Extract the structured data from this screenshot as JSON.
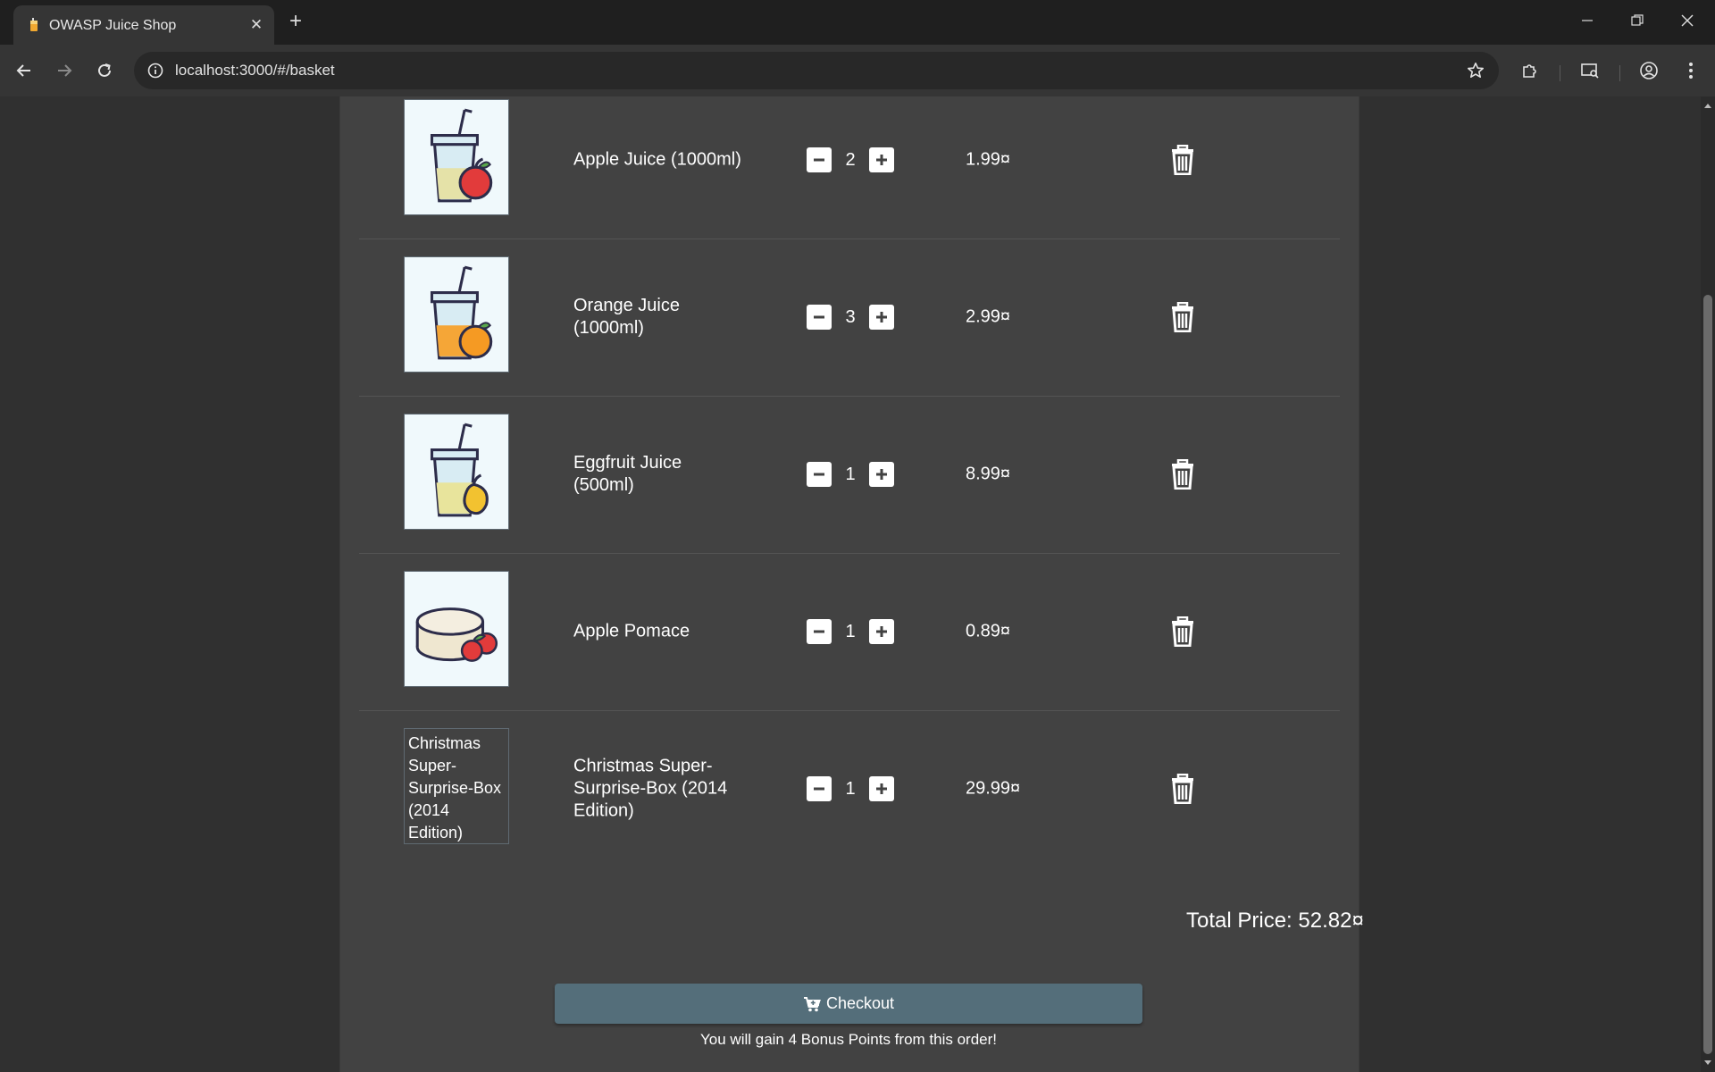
{
  "browser": {
    "tab_title": "OWASP Juice Shop",
    "url": "localhost:3000/#/basket"
  },
  "icons": {
    "favicon": "juice-shop-favicon",
    "back": "back-arrow-icon",
    "forward": "forward-arrow-icon",
    "reload": "reload-icon",
    "site_info": "info-icon",
    "bookmark": "star-icon",
    "extensions": "puzzle-icon",
    "profile": "profile-icon",
    "menu": "kebab-menu-icon",
    "decrease": "minus-square-icon",
    "increase": "plus-square-icon",
    "delete": "trash-icon",
    "checkout": "cart-icon"
  },
  "basket": {
    "items": [
      {
        "name": "Apple Juice (1000ml)",
        "quantity": "2",
        "price": "1.99¤",
        "image": "apple-juice"
      },
      {
        "name": "Orange Juice (1000ml)",
        "quantity": "3",
        "price": "2.99¤",
        "image": "orange-juice"
      },
      {
        "name": "Eggfruit Juice (500ml)",
        "quantity": "1",
        "price": "8.99¤",
        "image": "eggfruit-juice"
      },
      {
        "name": "Apple Pomace",
        "quantity": "1",
        "price": "0.89¤",
        "image": "apple-pomace"
      },
      {
        "name": "Christmas Super-Surprise-Box (2014 Edition)",
        "quantity": "1",
        "price": "29.99¤",
        "image": "broken",
        "image_alt": "Christmas Super-Surprise-Box (2014 Edition)"
      }
    ],
    "total_label": "Total Price: 52.82¤",
    "checkout_label": "Checkout",
    "bonus_text": "You will gain 4 Bonus Points from this order!"
  },
  "colors": {
    "accent": "#546e7a",
    "card": "#424242",
    "background": "#303030"
  }
}
